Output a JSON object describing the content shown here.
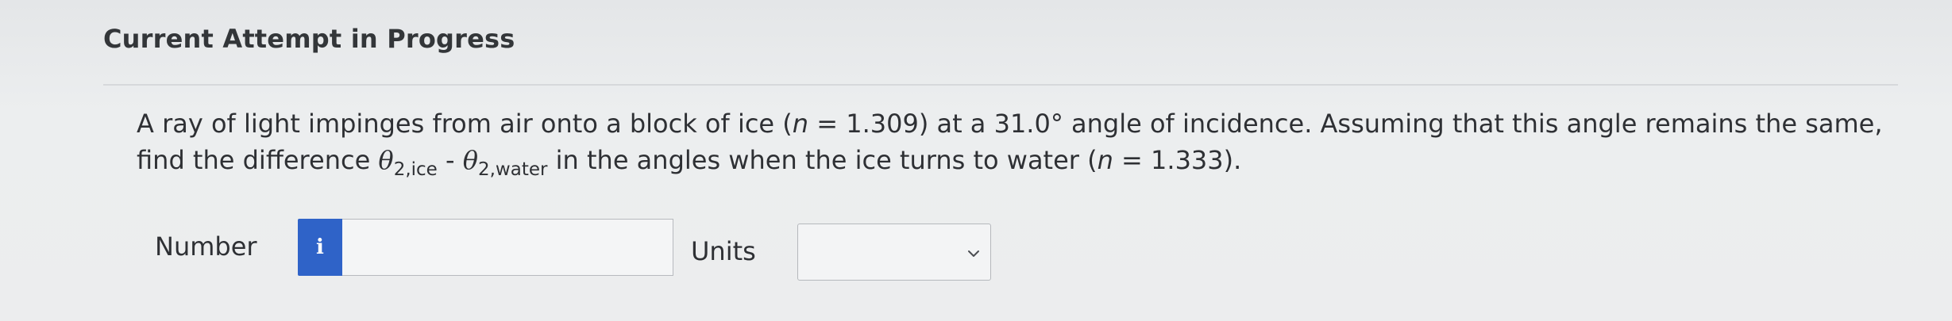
{
  "header": {
    "title": "Current Attempt in Progress"
  },
  "question": {
    "text_1": "A ray of light impinges from air onto a block of ice (",
    "n_symbol_1": "n",
    "text_2": " = 1.309) at a 31.0° angle of incidence. Assuming that this angle remains the same,",
    "text_3": "find the difference ",
    "theta_1": "θ",
    "sub_1": "2,ice",
    "minus": " - ",
    "theta_2": "θ",
    "sub_2": "2,water",
    "text_4": " in the angles when the ice turns to water (",
    "n_symbol_2": "n",
    "text_5": " = 1.333)."
  },
  "answer": {
    "number_label": "Number",
    "info_glyph": "i",
    "number_value": "",
    "units_label": "Units",
    "units_selected": ""
  },
  "icons": {
    "info": "info-icon",
    "dropdown": "chevron-down-icon"
  },
  "colors": {
    "info_button": "#2f63c8",
    "background": "#eceeef"
  }
}
